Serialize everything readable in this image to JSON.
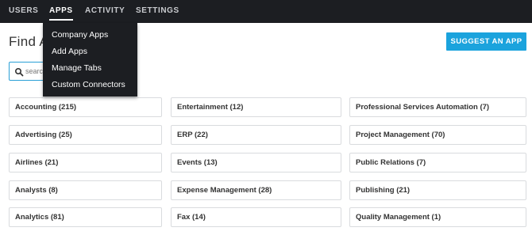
{
  "nav": {
    "items": [
      {
        "label": "USERS"
      },
      {
        "label": "APPS"
      },
      {
        "label": "ACTIVITY"
      },
      {
        "label": "SETTINGS"
      }
    ]
  },
  "apps_menu": {
    "items": [
      {
        "label": "Company Apps"
      },
      {
        "label": "Add Apps"
      },
      {
        "label": "Manage Tabs"
      },
      {
        "label": "Custom Connectors"
      }
    ]
  },
  "page": {
    "title": "Find Apps",
    "suggest_button": "SUGGEST AN APP",
    "search_placeholder": "search"
  },
  "categories": [
    [
      "Accounting (215)",
      "Entertainment (12)",
      "Professional Services Automation (7)"
    ],
    [
      "Advertising (25)",
      "ERP (22)",
      "Project Management (70)"
    ],
    [
      "Airlines (21)",
      "Events (13)",
      "Public Relations (7)"
    ],
    [
      "Analysts (8)",
      "Expense Management (28)",
      "Publishing (21)"
    ],
    [
      "Analytics (81)",
      "Fax (14)",
      "Quality Management (1)"
    ]
  ],
  "colors": {
    "nav_bg": "#1c1e22",
    "accent": "#1ba3dd"
  },
  "icons": {
    "search": "search-icon"
  }
}
